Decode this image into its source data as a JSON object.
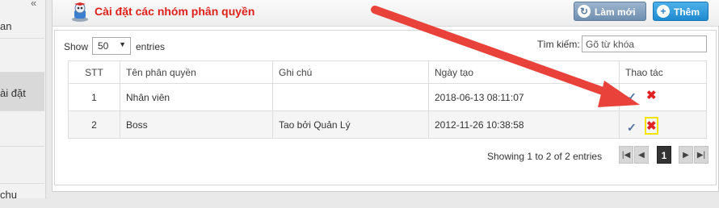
{
  "sidebar": {
    "collapse_symbol": "«",
    "items": [
      {
        "label": "an"
      },
      {
        "label": "ài đặt"
      },
      {
        "label": "chu"
      }
    ]
  },
  "header": {
    "title": "Cài đặt các nhóm phân quyền",
    "title_icon": "robot-settings-icon",
    "refresh_label": "Làm mới",
    "add_label": "Thêm"
  },
  "controls": {
    "show_label": "Show",
    "page_length": "50",
    "entries_label": "entries",
    "search_label": "Tìm kiếm:",
    "search_placeholder": "Gõ từ khóa",
    "search_value": ""
  },
  "table": {
    "columns": [
      "STT",
      "Tên phân quyền",
      "Ghi chú",
      "Ngày tạo",
      "Thao tác"
    ],
    "rows": [
      {
        "stt": "1",
        "name": "Nhân viên",
        "note": "",
        "created": "2018-06-13 08:11:07"
      },
      {
        "stt": "2",
        "name": "Boss",
        "note": "Tao bởi Quản Lý",
        "created": "2012-11-26 10:38:58"
      }
    ]
  },
  "footer": {
    "info": "Showing 1 to 2 of 2 entries",
    "current_page": "1"
  },
  "colors": {
    "title": "#e0201b",
    "annotation_arrow": "#e8423a",
    "highlight_box": "#f6e400",
    "delete_icon": "#e02222"
  }
}
